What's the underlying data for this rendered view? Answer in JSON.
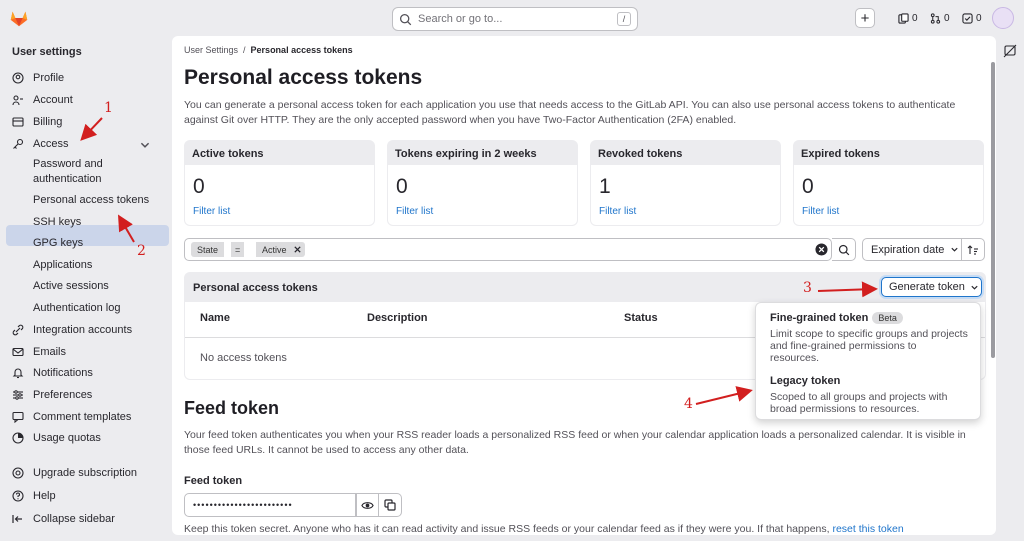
{
  "colors": {
    "accent": "#1f75cb",
    "annotation": "#d21f1f",
    "active_bg": "#cbd5ea"
  },
  "topbar": {
    "search_placeholder": "Search or go to...",
    "search_shortcut": "/",
    "issues_count": "0",
    "merge_requests_count": "0",
    "todos_count": "0"
  },
  "sidebar": {
    "title": "User settings",
    "items": [
      {
        "label": "Profile",
        "icon": "profile-icon"
      },
      {
        "label": "Account",
        "icon": "account-icon"
      },
      {
        "label": "Billing",
        "icon": "billing-icon"
      },
      {
        "label": "Access",
        "icon": "key-icon"
      },
      {
        "label": "Integration accounts",
        "icon": "integration-icon"
      },
      {
        "label": "Emails",
        "icon": "mail-icon"
      },
      {
        "label": "Notifications",
        "icon": "bell-icon"
      },
      {
        "label": "Preferences",
        "icon": "preferences-icon"
      },
      {
        "label": "Comment templates",
        "icon": "comment-icon"
      },
      {
        "label": "Usage quotas",
        "icon": "quota-icon"
      },
      {
        "label": "Upgrade subscription",
        "icon": "upgrade-icon"
      },
      {
        "label": "Help",
        "icon": "help-icon"
      },
      {
        "label": "Collapse sidebar",
        "icon": "collapse-icon"
      }
    ],
    "access_sub": [
      "Password and authentication",
      "Personal access tokens",
      "SSH keys",
      "GPG keys",
      "Applications",
      "Active sessions",
      "Authentication log"
    ]
  },
  "breadcrumb": {
    "parent": "User Settings",
    "separator": "/",
    "current": "Personal access tokens"
  },
  "page": {
    "title": "Personal access tokens",
    "description": "You can generate a personal access token for each application you use that needs access to the GitLab API. You can also use personal access tokens to authenticate against Git over HTTP. They are the only accepted password when you have Two-Factor Authentication (2FA) enabled."
  },
  "stats": [
    {
      "label": "Active tokens",
      "value": "0",
      "link": "Filter list"
    },
    {
      "label": "Tokens expiring in 2 weeks",
      "value": "0",
      "link": "Filter list"
    },
    {
      "label": "Revoked tokens",
      "value": "1",
      "link": "Filter list"
    },
    {
      "label": "Expired tokens",
      "value": "0",
      "link": "Filter list"
    }
  ],
  "filter": {
    "token_key": "State",
    "operator": "=",
    "token_value": "Active",
    "sort_label": "Expiration date"
  },
  "tokens_table": {
    "title": "Personal access tokens",
    "generate_label": "Generate token",
    "columns": [
      "Name",
      "Description",
      "Status"
    ],
    "empty_text": "No access tokens"
  },
  "dropdown": {
    "items": [
      {
        "title": "Fine-grained token",
        "badge": "Beta",
        "description": "Limit scope to specific groups and projects and fine-grained permissions to resources."
      },
      {
        "title": "Legacy token",
        "badge": "",
        "description": "Scoped to all groups and projects with broad permissions to resources."
      }
    ]
  },
  "feed": {
    "title": "Feed token",
    "description": "Your feed token authenticates you when your RSS reader loads a personalized RSS feed or when your calendar application loads a personalized calendar. It is visible in those feed URLs. It cannot be used to access any other data.",
    "label": "Feed token",
    "masked_value": "••••••••••••••••••••••••",
    "note": "Keep this token secret. Anyone who has it can read activity and issue RSS feeds or your calendar feed as if they were you. If that happens,",
    "reset_link": "reset this token"
  },
  "annotations": [
    "1",
    "2",
    "3",
    "4"
  ]
}
